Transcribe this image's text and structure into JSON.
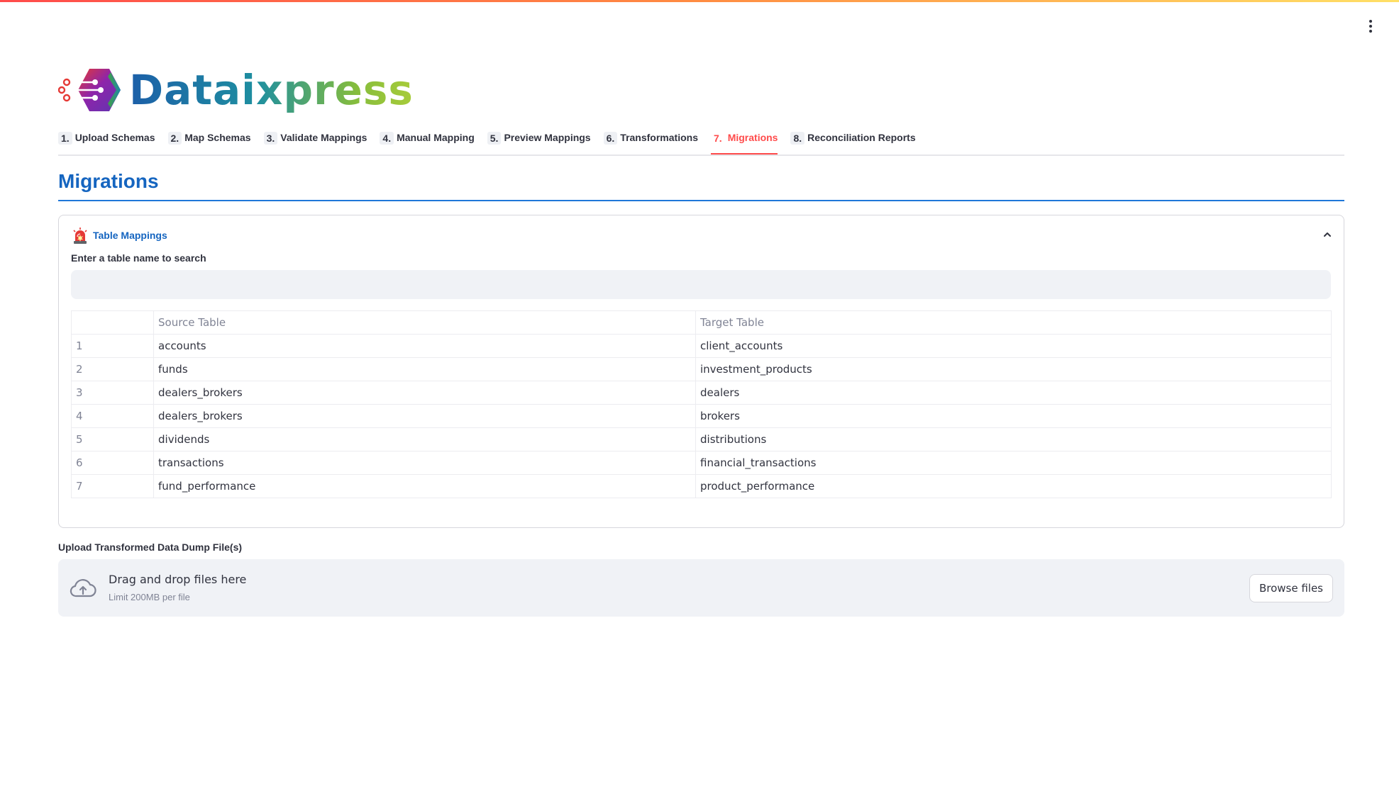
{
  "app": {
    "brand": "Dataixpress",
    "colors": {
      "accent": "#ff4b4b",
      "title_blue": "#1565c0",
      "rule_blue": "#1f77d8",
      "logo_gradient": [
        "#1c5fa8",
        "#86bd3c"
      ]
    }
  },
  "tabs": [
    {
      "num": "1.",
      "label": "Upload Schemas",
      "active": false
    },
    {
      "num": "2.",
      "label": "Map Schemas",
      "active": false
    },
    {
      "num": "3.",
      "label": "Validate Mappings",
      "active": false
    },
    {
      "num": "4.",
      "label": "Manual Mapping",
      "active": false
    },
    {
      "num": "5.",
      "label": "Preview Mappings",
      "active": false
    },
    {
      "num": "6.",
      "label": "Transformations",
      "active": false
    },
    {
      "num": "7.",
      "label": "Migrations",
      "active": true
    },
    {
      "num": "8.",
      "label": "Reconciliation Reports",
      "active": false
    }
  ],
  "page": {
    "title": "Migrations"
  },
  "expander": {
    "title": "Table Mappings",
    "icon": "siren-icon",
    "expanded": true,
    "search_label": "Enter a table name to search",
    "search_value": "",
    "search_placeholder": "",
    "table": {
      "columns": [
        "",
        "Source Table",
        "Target Table"
      ],
      "rows": [
        [
          "1",
          "accounts",
          "client_accounts"
        ],
        [
          "2",
          "funds",
          "investment_products"
        ],
        [
          "3",
          "dealers_brokers",
          "dealers"
        ],
        [
          "4",
          "dealers_brokers",
          "brokers"
        ],
        [
          "5",
          "dividends",
          "distributions"
        ],
        [
          "6",
          "transactions",
          "financial_transactions"
        ],
        [
          "7",
          "fund_performance",
          "product_performance"
        ]
      ]
    }
  },
  "upload": {
    "label": "Upload Transformed Data Dump File(s)",
    "drop_text": "Drag and drop files here",
    "limit_text": "Limit 200MB per file",
    "browse_label": "Browse files",
    "icon": "cloud-upload-icon"
  }
}
